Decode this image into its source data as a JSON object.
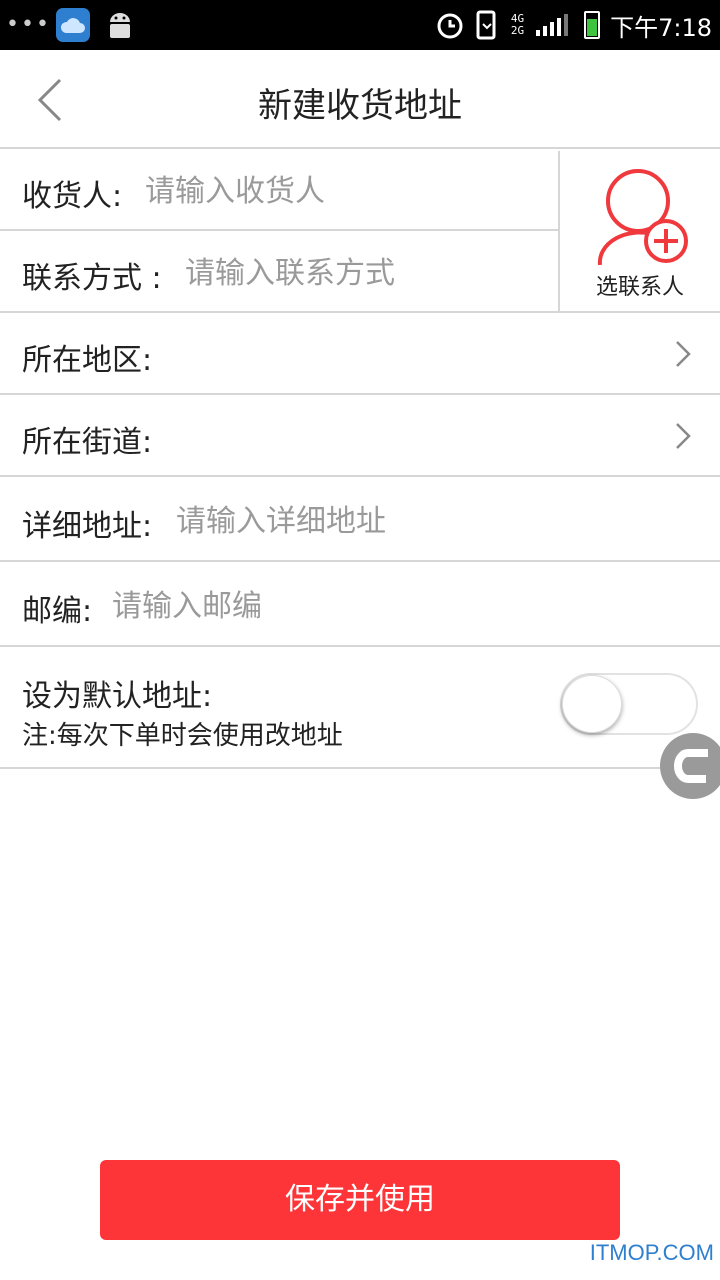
{
  "status_bar": {
    "dots": "•••",
    "network_top": "4G",
    "network_bottom": "2G",
    "time": "下午7:18",
    "battery_color": "#3ec43e"
  },
  "header": {
    "title": "新建收货地址",
    "back_icon": "chevron-left-icon"
  },
  "form": {
    "recipient": {
      "label": "收货人:",
      "placeholder": "请输入收货人",
      "value": ""
    },
    "contact": {
      "label": "联系方式 :",
      "placeholder": "请输入联系方式",
      "value": ""
    },
    "pick_contact": {
      "label": "选联系人",
      "icon": "add-person-icon"
    },
    "region": {
      "label": "所在地区:",
      "value": ""
    },
    "street": {
      "label": "所在街道:",
      "value": ""
    },
    "detail": {
      "label": "详细地址:",
      "placeholder": "请输入详细地址",
      "value": ""
    },
    "zip": {
      "label": "邮编:",
      "placeholder": "请输入邮编",
      "value": ""
    },
    "default_address": {
      "label": "设为默认地址:",
      "note": "注:每次下单时会使用改地址",
      "enabled": false
    }
  },
  "floating_button": {
    "icon": "c-icon"
  },
  "save_button": {
    "label": "保存并使用",
    "color": "#fd3539"
  },
  "watermark": "ITMOP.COM",
  "colors": {
    "accent": "#fd3539",
    "divider": "#d6d6d6",
    "placeholder": "#9a9a9a"
  }
}
